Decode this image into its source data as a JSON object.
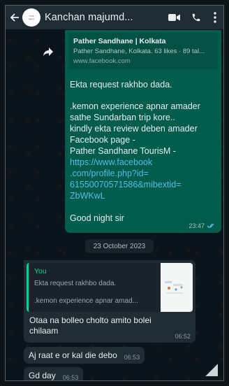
{
  "header": {
    "contact_name": "Kanchan majumd...",
    "icons": [
      "back-arrow-icon",
      "video-call-icon",
      "phone-icon",
      "more-options-icon"
    ]
  },
  "outgoing_message": {
    "link_preview": {
      "title": "Pather Sandhane | Kolkata",
      "description": "Pather Sandhane, Kolkata. 63 likes · 89 tal...",
      "domain": "www.facebook.com"
    },
    "line1": "Ekta request rakhbo dada.",
    "body_lines": [
      ".kemon experience apnar amader",
      "sathe Sundarban trip kore..",
      "kindly ekta review deben amader",
      "Facebook page -",
      "Pather Sandhane TourisM -"
    ],
    "link_lines": [
      "https://www.facebook",
      ".com/profile.php?id=",
      "61550070571586&mibextid=",
      "ZbWKwL"
    ],
    "closing": "Good night sir",
    "time": "23:47"
  },
  "date_separator": "23 October 2023",
  "incoming_reply": {
    "quote_author": "You",
    "quote_line1": "Ekta request rakhbo dada.",
    "quote_line2": ".kemon experience apnar amad...",
    "text_line1": "Otaa na bolleo cholto amito bolei",
    "text_line2": "chilaam",
    "time": "06:52"
  },
  "incoming_messages": [
    {
      "text": "Aj raat e or kal die debo",
      "time": "06:53"
    },
    {
      "text": "Gd day",
      "time": "06:53"
    }
  ],
  "colors": {
    "header_bg": "#1f2c33",
    "outgoing_bubble": "#005c4b",
    "incoming_bubble": "#202c33",
    "link": "#53bdeb",
    "quote_accent": "#06cf9c",
    "read_ticks": "#53bdeb"
  }
}
